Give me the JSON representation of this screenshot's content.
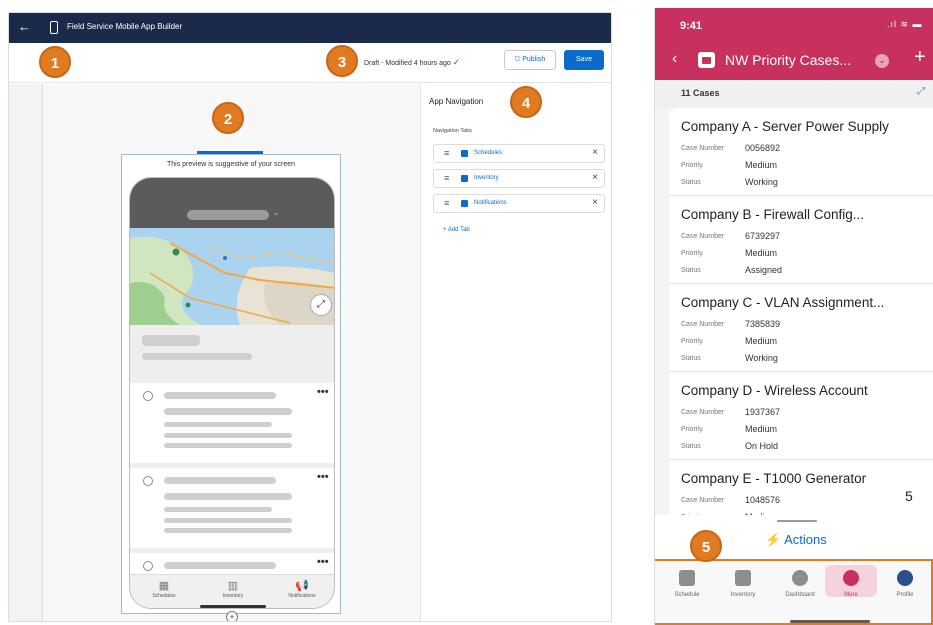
{
  "builder": {
    "app_title": "Field Service Mobile App Builder",
    "back_icon": "arrow-left-icon",
    "status_text": "Draft - Modified 4 hours ago",
    "publish_label": "Publish",
    "save_label": "Save",
    "preview_note": "This preview is suggestive of your screen",
    "nav_panel_title": "App Navigation",
    "nav_tabs_label": "Navigation Tabs",
    "nav_tabs": [
      {
        "label": "Schedules",
        "icon": "calendar-icon"
      },
      {
        "label": "Inventory",
        "icon": "inventory-icon"
      },
      {
        "label": "Notifications",
        "icon": "megaphone-icon"
      }
    ],
    "add_tab_label": "+  Add Tab",
    "preview_tabs": [
      "Schedules",
      "Inventory",
      "Notifications"
    ]
  },
  "badges": [
    "1",
    "2",
    "3",
    "4",
    "5"
  ],
  "mobile": {
    "time": "9:41",
    "signal": ".ıl ≋ ▬",
    "title": "NW Priority Cases...",
    "count_label": "11 Cases",
    "field_labels": {
      "case_number": "Case Number",
      "priority": "Priority",
      "status": "Status"
    },
    "cases": [
      {
        "title": "Company A - Server Power Supply",
        "case_number": "0056892",
        "priority": "Medium",
        "status": "Working"
      },
      {
        "title": "Company B - Firewall Config...",
        "case_number": "6739297",
        "priority": "Medium",
        "status": "Assigned"
      },
      {
        "title": "Company C - VLAN Assignment...",
        "case_number": "7385839",
        "priority": "Medium",
        "status": "Working"
      },
      {
        "title": "Company D - Wireless Account",
        "case_number": "1937367",
        "priority": "Medium",
        "status": "On Hold"
      },
      {
        "title": "Company E - T1000 Generator",
        "case_number": "1048576",
        "priority": "Medium",
        "status": ""
      }
    ],
    "annotation_five": "5",
    "actions_label": "⚡ Actions",
    "tabs": [
      {
        "label": "Schedule",
        "icon": "calendar-icon"
      },
      {
        "label": "Inventory",
        "icon": "inventory-icon"
      },
      {
        "label": "Dashboard",
        "icon": "dashboard-icon"
      },
      {
        "label": "More",
        "icon": "more-icon"
      },
      {
        "label": "Profile",
        "icon": "avatar-icon"
      }
    ]
  },
  "colors": {
    "accent": "#c8305d",
    "brand_blue": "#0b6bcb",
    "badge": "#e07b22",
    "topbar": "#1b2a4a"
  }
}
